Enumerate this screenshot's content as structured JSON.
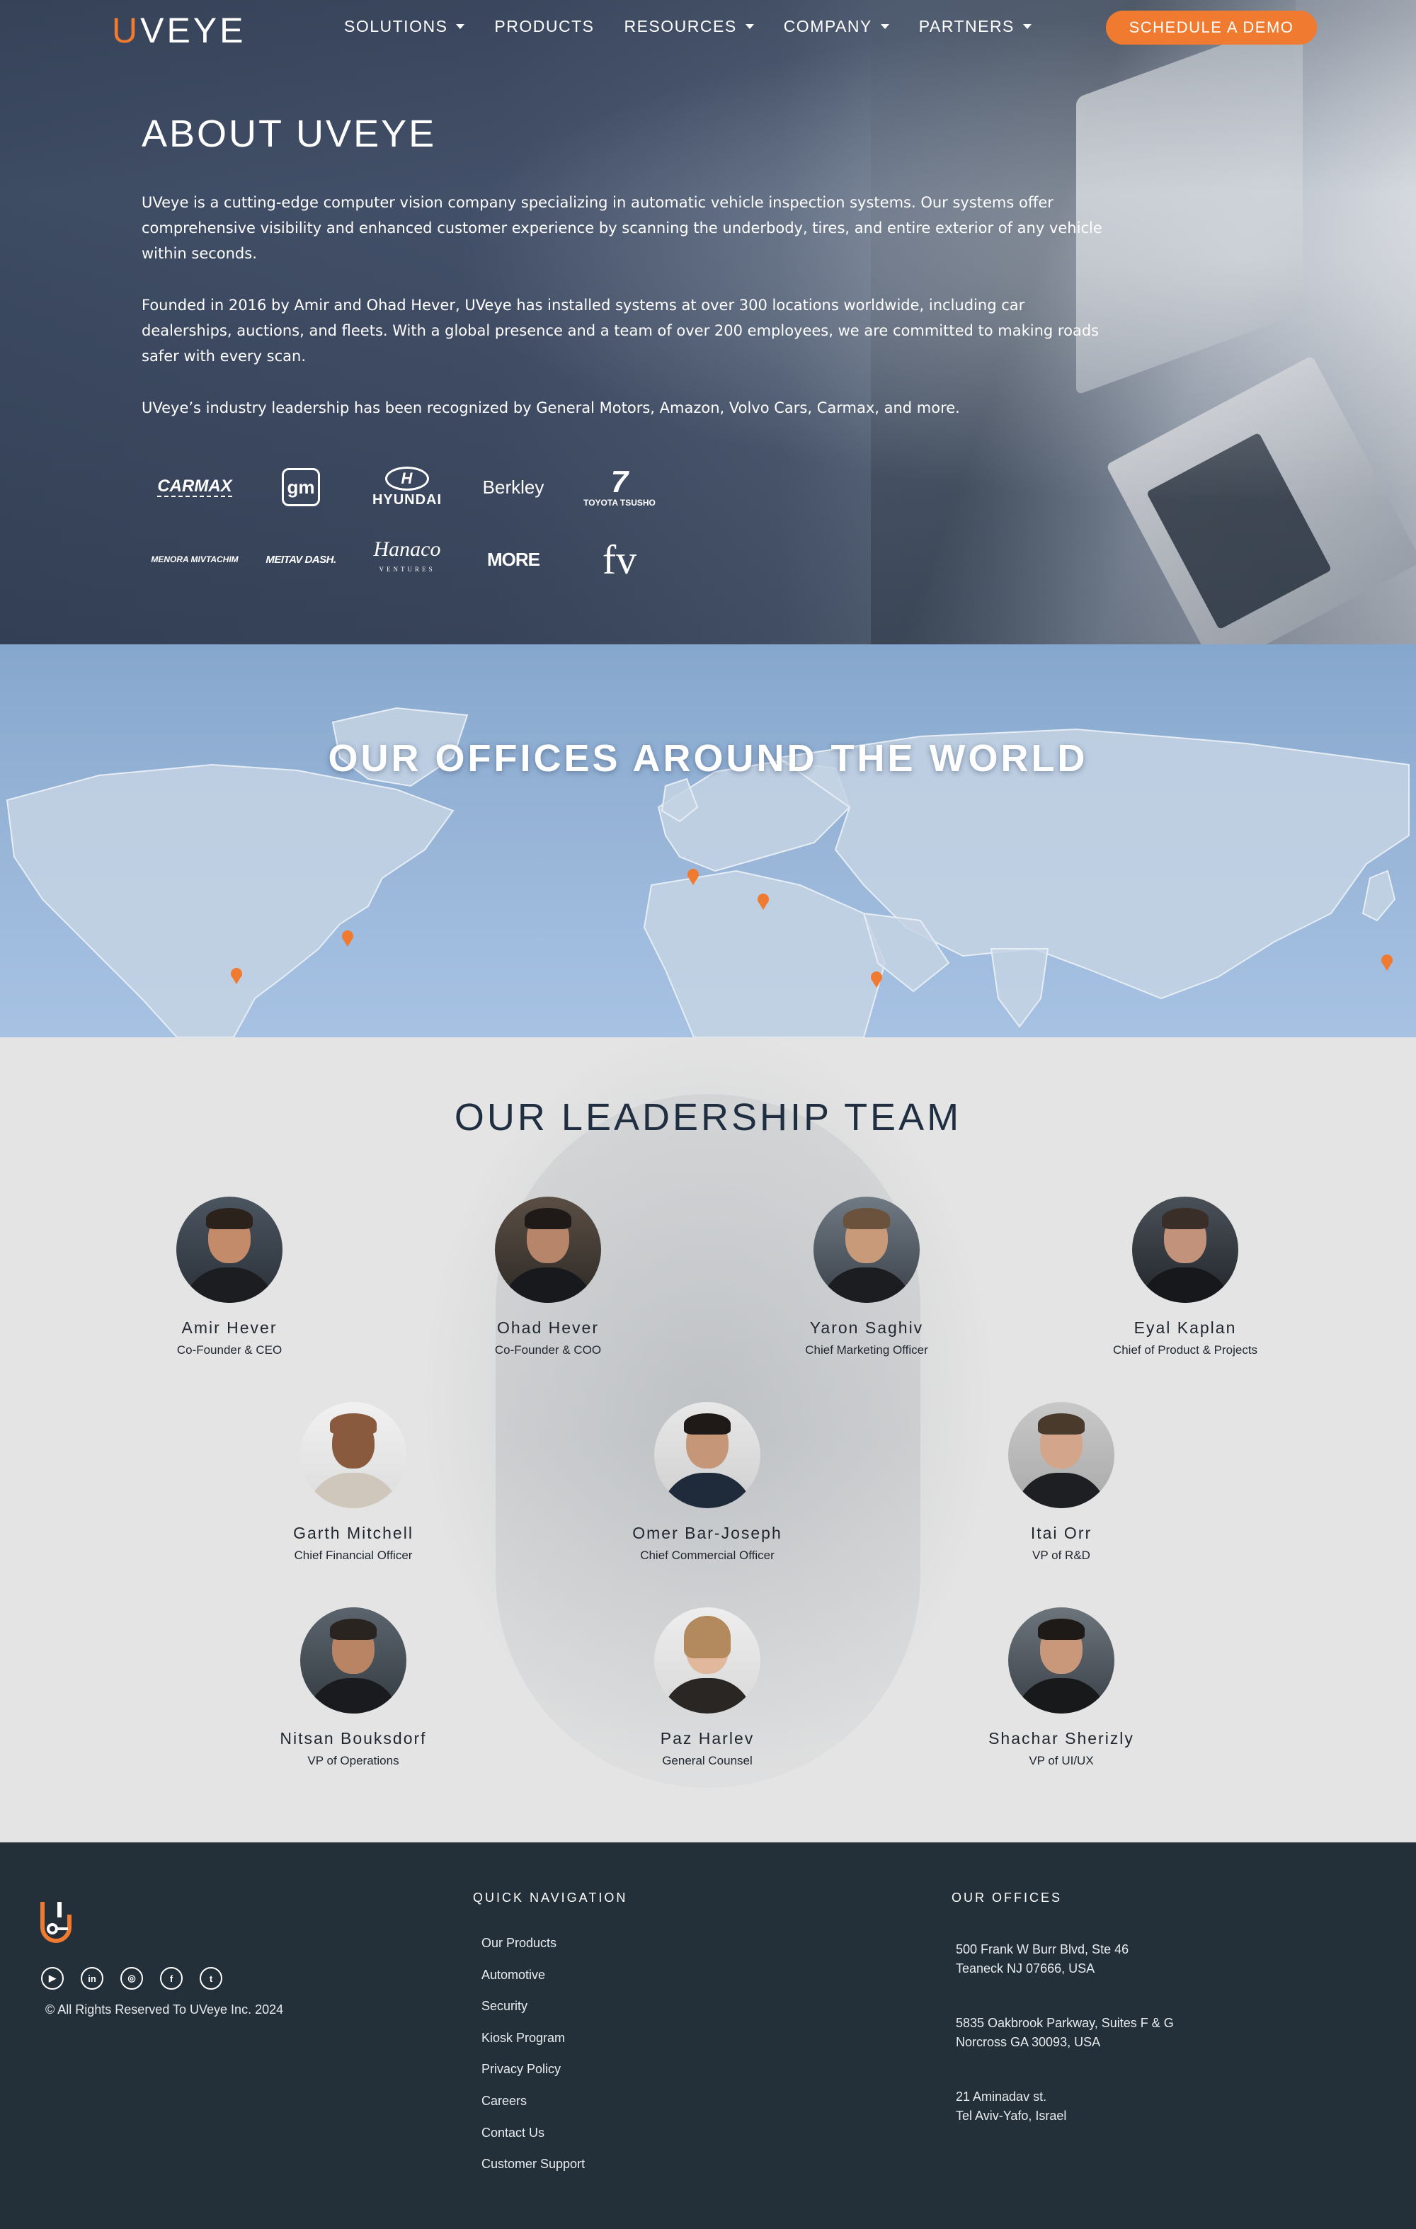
{
  "header": {
    "logo_u": "U",
    "logo_rest": "VEYE",
    "nav": [
      {
        "label": "SOLUTIONS",
        "dropdown": true
      },
      {
        "label": "PRODUCTS",
        "dropdown": false
      },
      {
        "label": "RESOURCES",
        "dropdown": true
      },
      {
        "label": "COMPANY",
        "dropdown": true
      },
      {
        "label": "PARTNERS",
        "dropdown": true
      }
    ],
    "cta_label": "SCHEDULE A DEMO"
  },
  "about": {
    "title": "ABOUT UVEYE",
    "paragraphs": [
      "UVeye is a cutting-edge computer vision company specializing in automatic vehicle inspection systems. Our systems offer comprehensive visibility and enhanced customer experience by scanning the underbody, tires, and entire exterior of any vehicle within seconds.",
      "Founded in 2016 by Amir and Ohad Hever, UVeye has installed systems at over 300 locations worldwide, including car dealerships, auctions, and fleets. With a global presence and a team of over 200 employees, we are committed to making roads safer with every scan.",
      "UVeye’s industry leadership has been recognized by General Motors, Amazon, Volvo Cars, Carmax, and more."
    ],
    "partners_row1": [
      "carmax",
      "gm",
      "HYUNDAI",
      "Berkley",
      "TOYOTA TSUSHO"
    ],
    "partners_row2": [
      "MENORA MIVTACHIM",
      "MEITAV DASH",
      "Hanaco",
      "MORE",
      "fv"
    ],
    "partner_logo_text": {
      "carmax": "CARMAX",
      "gm": "gm",
      "hyundai": "HYUNDAI",
      "berkley": "Berkley",
      "toyota": "TOYOTA TSUSHO",
      "menora": "MENORA MIVTACHIM",
      "meitav": "MEITAV DASH.",
      "hanaco": "Hanaco",
      "hanaco_sub": "VENTURES",
      "more": "MORE",
      "fv": "fv"
    }
  },
  "offices_section": {
    "title": "OUR OFFICES AROUND THE WORLD",
    "pin_color": "#f07a2f"
  },
  "leadership": {
    "title": "OUR LEADERSHIP TEAM",
    "members": [
      {
        "name": "Amir Hever",
        "role": "Co-Founder & CEO"
      },
      {
        "name": "Ohad Hever",
        "role": "Co-Founder & COO"
      },
      {
        "name": "Yaron Saghiv",
        "role": "Chief Marketing Officer"
      },
      {
        "name": "Eyal Kaplan",
        "role": "Chief of Product & Projects"
      },
      {
        "name": "Garth Mitchell",
        "role": "Chief Financial Officer"
      },
      {
        "name": "Omer Bar-Joseph",
        "role": "Chief Commercial Officer"
      },
      {
        "name": "Itai Orr",
        "role": "VP of R&D"
      },
      {
        "name": "Nitsan Bouksdorf",
        "role": "VP of Operations"
      },
      {
        "name": "Paz Harlev",
        "role": "General Counsel"
      },
      {
        "name": "Shachar Sherizly",
        "role": "VP of UI/UX"
      }
    ]
  },
  "footer": {
    "socials": [
      "youtube-icon",
      "linkedin-icon",
      "instagram-icon",
      "facebook-icon",
      "twitter-icon"
    ],
    "copyright": "© All Rights Reserved To UVeye Inc. 2024",
    "quick_nav_title": "QUICK NAVIGATION",
    "quick_nav": [
      "Our Products",
      "Automotive",
      "Security",
      "Kiosk Program",
      "Privacy Policy",
      "Careers",
      "Contact Us",
      "Customer Support"
    ],
    "offices_title": "OUR OFFICES",
    "offices": [
      {
        "line1": "500 Frank W Burr Blvd, Ste 46",
        "line2": "Teaneck NJ 07666, USA"
      },
      {
        "line1": "5835 Oakbrook Parkway, Suites F & G",
        "line2": "Norcross GA 30093, USA"
      },
      {
        "line1": "21 Aminadav st.",
        "line2": "Tel Aviv-Yafo, Israel"
      }
    ]
  },
  "colors": {
    "accent": "#f07a2f",
    "footer_bg": "#243039",
    "title_dark": "#1f2e40"
  }
}
